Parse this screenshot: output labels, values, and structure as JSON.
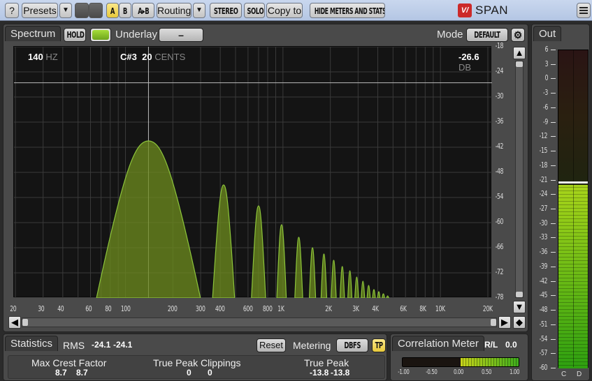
{
  "toolbar": {
    "help_label": "?",
    "presets_label": "Presets",
    "dropdown_glyph": "▼",
    "a_label": "A",
    "b_label": "B",
    "ab_label": "A▸B",
    "routing_label": "Routing",
    "stereo_label": "STEREO",
    "solo_label": "SOLO",
    "copy_to_label": "Copy to",
    "hide_meters_label": "HIDE METERS AND STATS",
    "app_title": "SPAN",
    "logo_glyph": "V/",
    "menu_icon": "hamburger-icon"
  },
  "spectrum": {
    "tab_label": "Spectrum",
    "hold_label": "HOLD",
    "underlay_label": "Underlay",
    "underlay_value": "–",
    "mode_label": "Mode",
    "mode_value": "DEFAULT",
    "settings_icon": "gear-icon",
    "readout": {
      "freq": "140",
      "freq_unit": "HZ",
      "note": "C#3",
      "cents": "20",
      "cents_unit": "CENTS",
      "level": "-26.6",
      "level_unit": "DB"
    },
    "y_ticks": [
      "-18",
      "-24",
      "-30",
      "-36",
      "-42",
      "-48",
      "-54",
      "-60",
      "-66",
      "-72",
      "-78"
    ],
    "x_ticks": [
      "20",
      "30",
      "40",
      "60",
      "80",
      "100",
      "200",
      "300",
      "400",
      "600",
      "800",
      "1K",
      "2K",
      "3K",
      "4K",
      "6K",
      "8K",
      "10K",
      "20K"
    ],
    "accent_color": "#8cc43a"
  },
  "statistics": {
    "tab_label": "Statistics",
    "rms_label": "RMS",
    "rms_values": [
      "-24.1",
      "-24.1"
    ],
    "reset_label": "Reset",
    "metering_label": "Metering",
    "metering_value": "DBFS",
    "tp_label": "TP",
    "max_crest_label": "Max Crest Factor",
    "max_crest_values": [
      "8.7",
      "8.7"
    ],
    "tp_clip_label": "True Peak Clippings",
    "tp_clip_values": [
      "0",
      "0"
    ],
    "true_peak_label": "True Peak",
    "true_peak_values": [
      "-13.8",
      "-13.8"
    ]
  },
  "correlation": {
    "tab_label": "Correlation Meter",
    "channel_label": "R/L",
    "value": "0.0",
    "scale": [
      "-1.00",
      "-0.50",
      "0.00",
      "0.50",
      "1.00"
    ]
  },
  "out_meter": {
    "tab_label": "Out",
    "ticks": [
      "6",
      "3",
      "0",
      "-3",
      "-6",
      "-9",
      "-12",
      "-15",
      "-18",
      "-21",
      "-24",
      "-27",
      "-30",
      "-33",
      "-36",
      "-39",
      "-42",
      "-45",
      "-48",
      "-51",
      "-54",
      "-57",
      "-60"
    ],
    "channel_labels": [
      "C",
      "D"
    ],
    "level_db": -22,
    "peak_db": -21.5
  }
}
